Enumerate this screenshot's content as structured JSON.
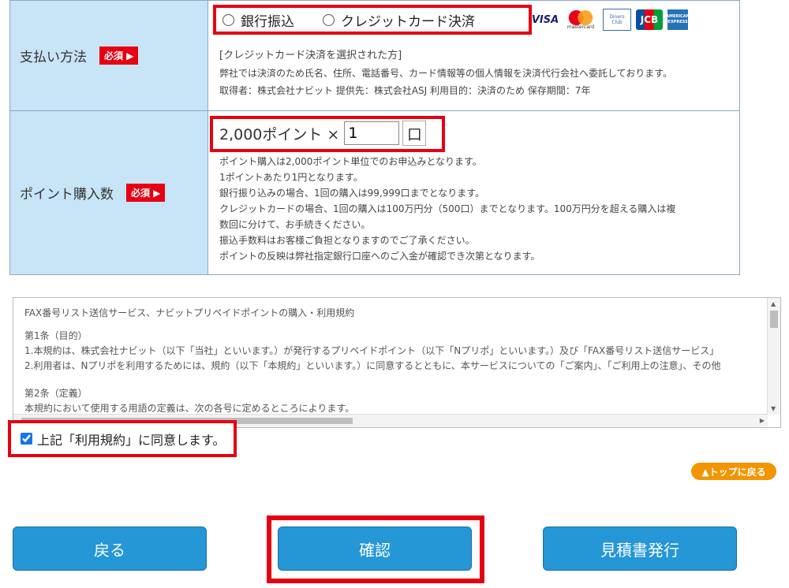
{
  "payment": {
    "label": "支払い方法",
    "required": "必須 ▶",
    "options": [
      "銀行振込",
      "クレジットカード決済"
    ],
    "cards": {
      "visa": "VISA",
      "mastercard": "mastercard",
      "diners": "Diners Club",
      "jcb": "JCB",
      "amex": "AMERICAN EXPRESS"
    },
    "note1": "[クレジットカード決済を選択された方]",
    "note2": "弊社では決済のため氏名、住所、電話番号、カード情報等の個人情報を決済代行会社へ委託しております。",
    "note3": "取得者：株式会社ナビット 提供先：株式会社ASJ 利用目的：決済のため 保存期間：7年"
  },
  "points": {
    "label": "ポイント購入数",
    "required": "必須 ▶",
    "unit_text": "2,000ポイント ×",
    "quantity": "1",
    "unit_suffix": "口",
    "notes": [
      "ポイント購入は2,000ポイント単位でのお申込みとなります。",
      "1ポイントあたり1円となります。",
      "銀行振り込みの場合、1回の購入は99,999口までとなります。",
      "クレジットカードの場合、1回の購入は100万円分（500口）までとなります。100万円分を超える購入は複",
      "数回に分けて、お手続きください。",
      "振込手数料はお客様ご負担となりますのでご了承ください。",
      "ポイントの反映は弊社指定銀行口座へのご入金が確認でき次第となります。"
    ]
  },
  "terms": {
    "title": "FAX番号リスト送信サービス、ナビットプリペイドポイントの購入・利用規約",
    "art1": "第1条（目的）",
    "art1_1": "1.本規約は、株式会社ナビット（以下「当社」といいます。）が発行するプリペイドポイント（以下「Nプリポ」といいます。）及び「FAX番号リスト送信サービス」",
    "art1_2": "2.利用者は、Nプリポを利用するためには、規約（以下「本規約」といいます。）に同意するとともに、本サービスについての「ご案内」、「ご利用上の注意」、その他",
    "art2": "第2条（定義）",
    "art2_1": "本規約において使用する用語の定義は、次の各号に定めるところによります。"
  },
  "agree_label": "上記「利用規約」に同意します。",
  "back_to_top": "▲トップに戻る",
  "buttons": {
    "back": "戻る",
    "confirm": "確認",
    "estimate": "見積書発行"
  }
}
